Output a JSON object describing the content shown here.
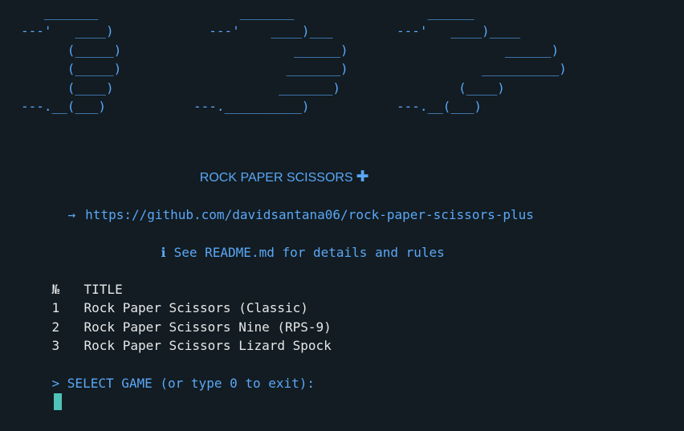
{
  "art": {
    "rock": "   _______\n---'   ____)\n      (_____)\n      (_____)\n      (____)\n---.__(___)",
    "paper": "      _______\n  ---'    ____)___\n             ______)\n            _______)\n           _______)\n---.__________)",
    "scissors": "    ______\n---'   ____)____\n              ______)\n           __________)\n        (____)\n---.__(___)"
  },
  "header": {
    "title": "ROCK PAPER SCISSORS",
    "title_symbol": "✚"
  },
  "link": {
    "arrow": "→",
    "url": "https://github.com/davidsantana06/rock-paper-scissors-plus"
  },
  "readme": {
    "icon": "ℹ",
    "text": "See README.md for details and rules"
  },
  "table": {
    "headers": [
      "№",
      "TITLE"
    ],
    "rows": [
      {
        "num": "1",
        "title": "Rock Paper Scissors (Classic)"
      },
      {
        "num": "2",
        "title": "Rock Paper Scissors Nine (RPS-9)"
      },
      {
        "num": "3",
        "title": "Rock Paper Scissors Lizard Spock"
      }
    ]
  },
  "prompt": {
    "text": "> SELECT GAME (or type 0 to exit):"
  },
  "colors": {
    "background": "#121c22",
    "accent": "#5ba7f7",
    "text": "#e6e8ea",
    "cursor": "#4fc3b8"
  }
}
